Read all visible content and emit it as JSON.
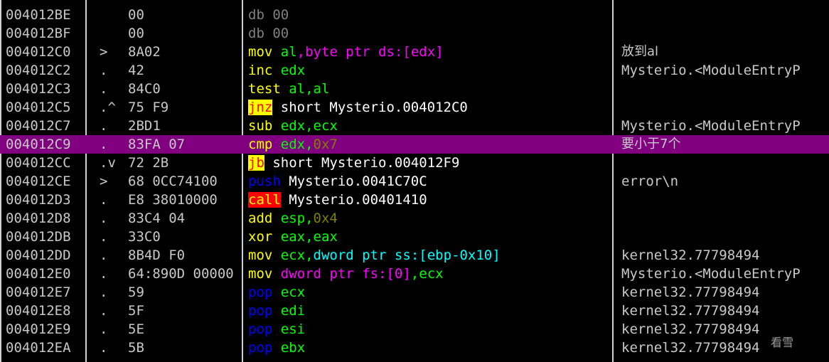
{
  "colors": {
    "background": "#000000",
    "selected_row": "#800080",
    "text": "#c8c8c8",
    "mnemonic_mov": "#ffff00",
    "mnemonic_inc": "#00ff00",
    "mnemonic_push_pop": "#0000ff",
    "register": "#00ff00",
    "ptr_size": "#ff00ff",
    "memory_ref": "#00ffff",
    "immediate": "#808000",
    "jump_highlight_bg": "#ffff00",
    "call_highlight_bg": "#ff0000",
    "db_gray": "#808080"
  },
  "rows": [
    {
      "addr": "004012BE",
      "mark": "",
      "hex": "00",
      "cmt": "",
      "segs": [
        {
          "t": "db 00",
          "c": "#808080"
        }
      ]
    },
    {
      "addr": "004012BF",
      "mark": "",
      "hex": "00",
      "cmt": "",
      "segs": [
        {
          "t": "db 00",
          "c": "#808080"
        }
      ]
    },
    {
      "addr": "004012C0",
      "mark": ">",
      "hex": "8A02",
      "cmt": "放到al",
      "segs": [
        {
          "t": "mov",
          "c": "#ffff00"
        },
        {
          "t": " al",
          "c": "#00ff00"
        },
        {
          "t": ",",
          "c": "#ff00ff"
        },
        {
          "t": "byte ptr ds:",
          "c": "#ff00ff"
        },
        {
          "t": "[edx]",
          "c": "#ff00ff"
        }
      ]
    },
    {
      "addr": "004012C2",
      "mark": ".",
      "hex": "42",
      "cmt": "Mysterio.<ModuleEntryP",
      "segs": [
        {
          "t": "inc",
          "c": "#ffff00"
        },
        {
          "t": " edx",
          "c": "#00ff00"
        }
      ]
    },
    {
      "addr": "004012C3",
      "mark": ".",
      "hex": "84C0",
      "cmt": "",
      "segs": [
        {
          "t": "test",
          "c": "#ffff00"
        },
        {
          "t": " al",
          "c": "#00ff00"
        },
        {
          "t": ",",
          "c": "#00ff00"
        },
        {
          "t": "al",
          "c": "#00ff00"
        }
      ]
    },
    {
      "addr": "004012C5",
      "mark": ".^",
      "hex": "75 F9",
      "cmt": "",
      "segs": [
        {
          "t": "jnz",
          "c": "#ff0000",
          "hl": "j"
        },
        {
          "t": " short Mysterio.004012C0",
          "c": "#ffffff"
        }
      ]
    },
    {
      "addr": "004012C7",
      "mark": ".",
      "hex": "2BD1",
      "cmt": "Mysterio.<ModuleEntryP",
      "segs": [
        {
          "t": "sub",
          "c": "#ffff00"
        },
        {
          "t": " edx",
          "c": "#00ff00"
        },
        {
          "t": ",",
          "c": "#00ff00"
        },
        {
          "t": "ecx",
          "c": "#00ff00"
        }
      ]
    },
    {
      "addr": "004012C9",
      "mark": ".",
      "hex": "83FA 07",
      "cmt": "要小于7个",
      "sel": true,
      "segs": [
        {
          "t": "cmp",
          "c": "#ffff00"
        },
        {
          "t": " edx",
          "c": "#00ff00"
        },
        {
          "t": ",",
          "c": "#00ff00"
        },
        {
          "t": "0x7",
          "c": "#808000"
        }
      ]
    },
    {
      "addr": "004012CC",
      "mark": ".v",
      "hex": "72 2B",
      "cmt": "",
      "segs": [
        {
          "t": "jb",
          "c": "#ff0000",
          "hl": "j"
        },
        {
          "t": " short Mysterio.004012F9",
          "c": "#ffffff"
        }
      ]
    },
    {
      "addr": "004012CE",
      "mark": ">",
      "hex": "68 0CC74100",
      "cmt": "error\\n",
      "segs": [
        {
          "t": "push",
          "c": "#0000ff"
        },
        {
          "t": " Mysterio.0041C70C",
          "c": "#ffffff"
        }
      ]
    },
    {
      "addr": "004012D3",
      "mark": ".",
      "hex": "E8 38010000",
      "cmt": "",
      "segs": [
        {
          "t": "call",
          "c": "#ffff00",
          "hl": "call"
        },
        {
          "t": " Mysterio.00401410",
          "c": "#ffffff"
        }
      ]
    },
    {
      "addr": "004012D8",
      "mark": ".",
      "hex": "83C4 04",
      "cmt": "",
      "segs": [
        {
          "t": "add",
          "c": "#ffff00"
        },
        {
          "t": " esp",
          "c": "#00ff00"
        },
        {
          "t": ",",
          "c": "#00ff00"
        },
        {
          "t": "0x4",
          "c": "#808000"
        }
      ]
    },
    {
      "addr": "004012DB",
      "mark": ".",
      "hex": "33C0",
      "cmt": "",
      "segs": [
        {
          "t": "xor",
          "c": "#ffff00"
        },
        {
          "t": " eax",
          "c": "#00ff00"
        },
        {
          "t": ",",
          "c": "#00ff00"
        },
        {
          "t": "eax",
          "c": "#00ff00"
        }
      ]
    },
    {
      "addr": "004012DD",
      "mark": ".",
      "hex": "8B4D F0",
      "cmt": "kernel32.77798494",
      "segs": [
        {
          "t": "mov",
          "c": "#ffff00"
        },
        {
          "t": " ecx",
          "c": "#00ff00"
        },
        {
          "t": ",",
          "c": "#00ff00"
        },
        {
          "t": "dword ptr ss:[ebp-0x10]",
          "c": "#00ffff"
        }
      ]
    },
    {
      "addr": "004012E0",
      "mark": ".",
      "hex": "64:890D 00000",
      "cmt": "Mysterio.<ModuleEntryP",
      "segs": [
        {
          "t": "mov",
          "c": "#ffff00"
        },
        {
          "t": " dword ptr fs:[0]",
          "c": "#ff00ff"
        },
        {
          "t": ",",
          "c": "#00ff00"
        },
        {
          "t": "ecx",
          "c": "#00ff00"
        }
      ]
    },
    {
      "addr": "004012E7",
      "mark": ".",
      "hex": "59",
      "cmt": "kernel32.77798494",
      "segs": [
        {
          "t": "pop",
          "c": "#0000ff"
        },
        {
          "t": " ecx",
          "c": "#00ff00"
        }
      ]
    },
    {
      "addr": "004012E8",
      "mark": ".",
      "hex": "5F",
      "cmt": "kernel32.77798494",
      "segs": [
        {
          "t": "pop",
          "c": "#0000ff"
        },
        {
          "t": " edi",
          "c": "#00ff00"
        }
      ]
    },
    {
      "addr": "004012E9",
      "mark": ".",
      "hex": "5E",
      "cmt": "kernel32.77798494",
      "segs": [
        {
          "t": "pop",
          "c": "#0000ff"
        },
        {
          "t": " esi",
          "c": "#00ff00"
        }
      ]
    },
    {
      "addr": "004012EA",
      "mark": ".",
      "hex": "5B",
      "cmt": "kernel32.77798494",
      "segs": [
        {
          "t": "pop",
          "c": "#0000ff"
        },
        {
          "t": " ebx",
          "c": "#00ff00"
        }
      ]
    }
  ],
  "watermark": "看雪"
}
